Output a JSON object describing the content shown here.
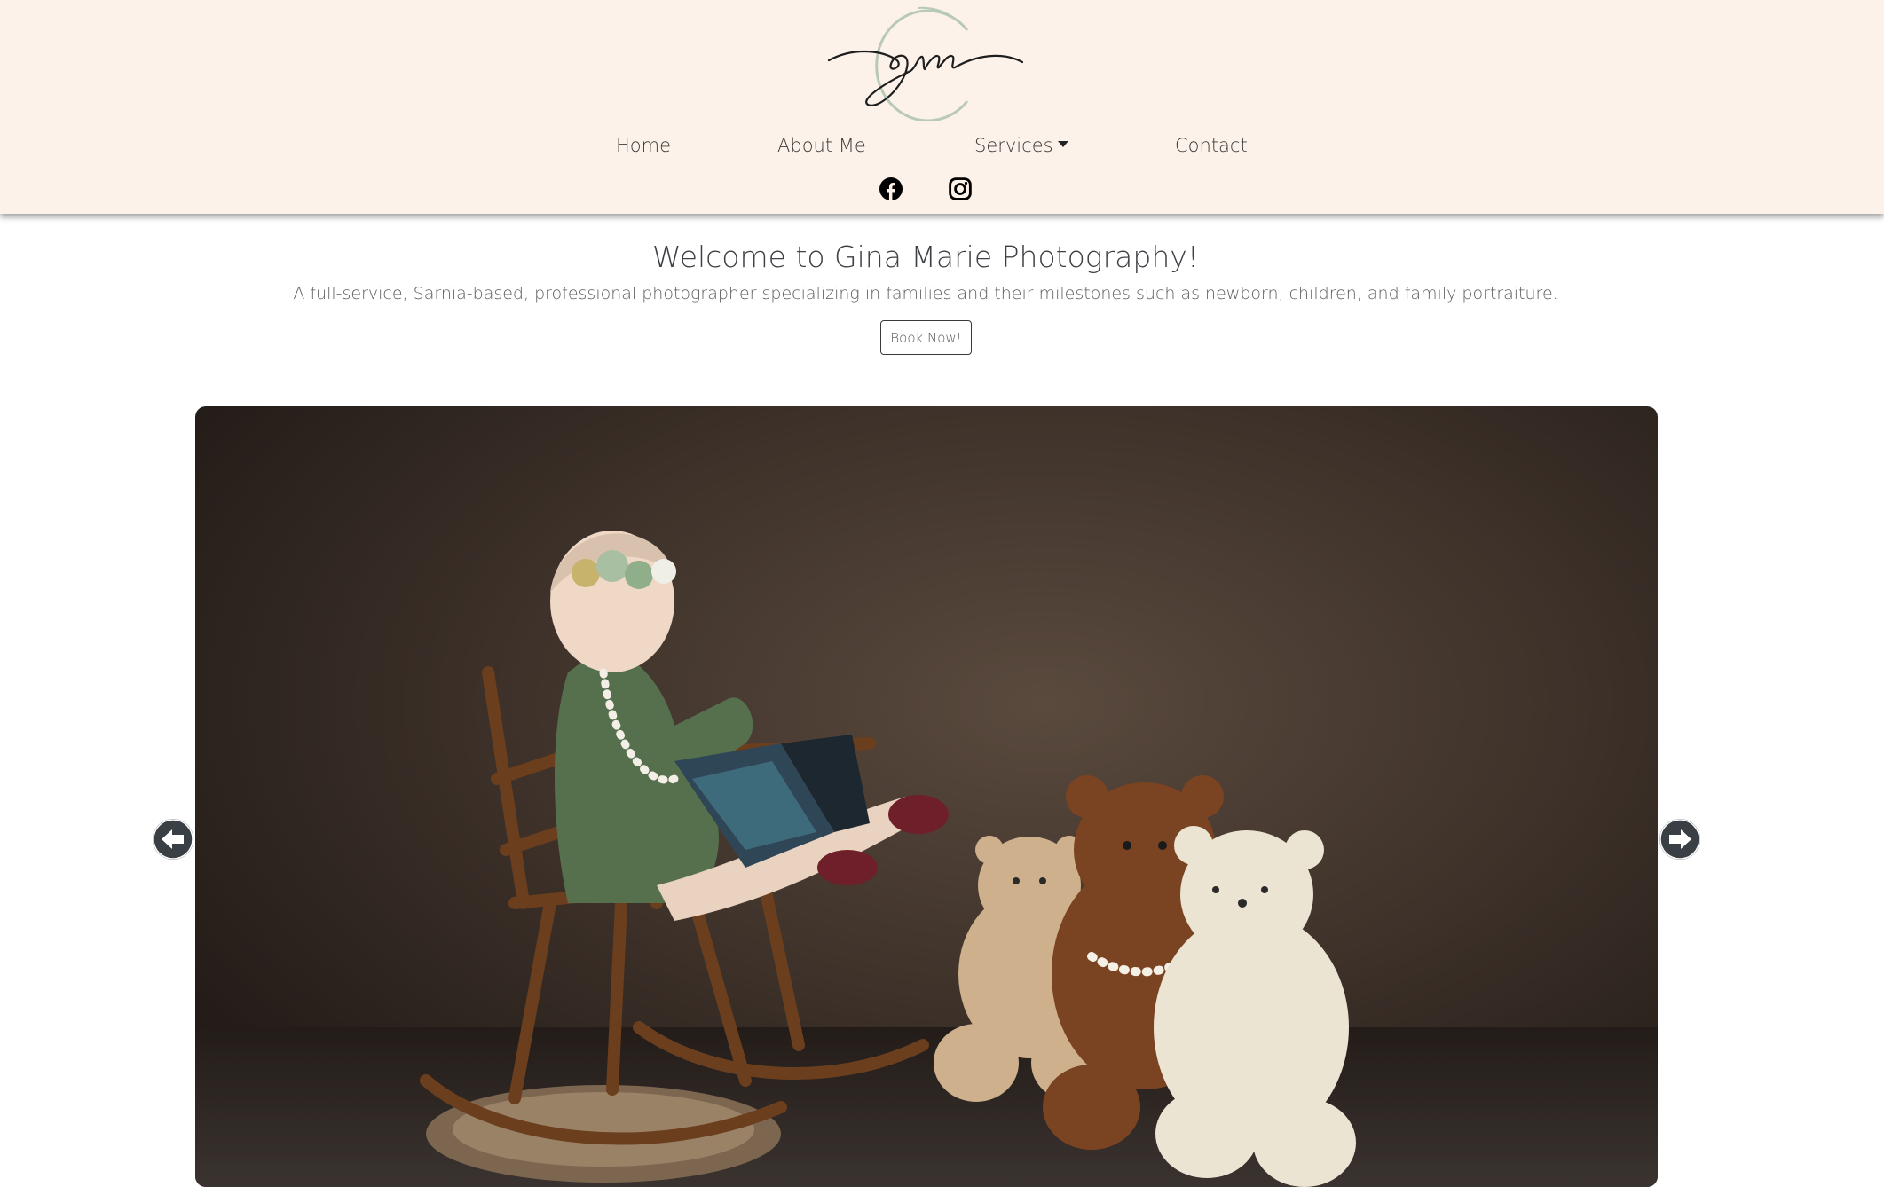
{
  "brand": {
    "monogram": "gm",
    "accent_color": "#b9c9b8",
    "header_bg": "#fdf2ea"
  },
  "nav": {
    "items": [
      {
        "label": "Home"
      },
      {
        "label": "About Me"
      },
      {
        "label": "Services",
        "has_dropdown": true
      },
      {
        "label": "Contact"
      }
    ]
  },
  "social": {
    "icons": [
      "facebook-icon",
      "instagram-icon"
    ]
  },
  "intro": {
    "title": "Welcome to Gina Marie Photography!",
    "subtitle": "A full-service, Sarnia-based, professional photographer specializing in families and their milestones such as newborn, children, and family portraiture.",
    "button_label": "Book Now!"
  },
  "carousel": {
    "prev_icon": "arrow-left-circle-icon",
    "next_icon": "arrow-right-circle-icon"
  }
}
